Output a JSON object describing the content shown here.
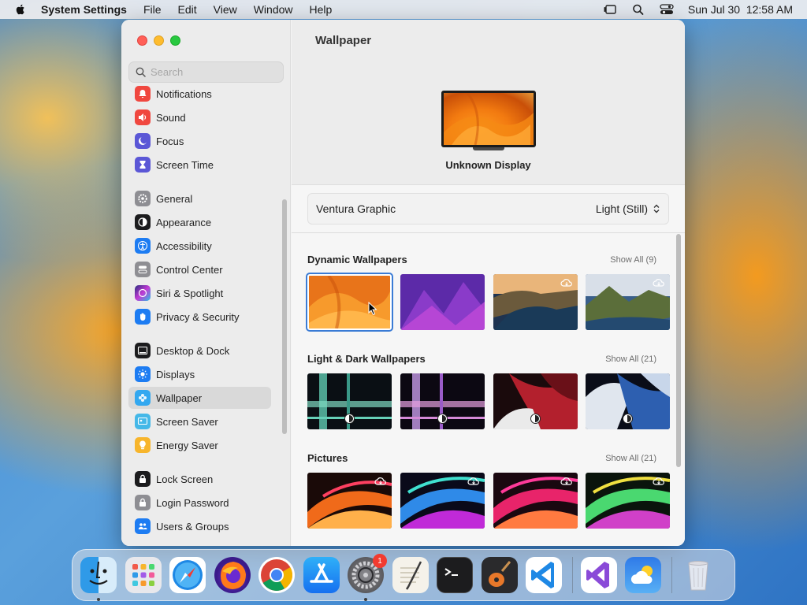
{
  "menubar": {
    "app_name": "System Settings",
    "items": [
      "File",
      "Edit",
      "View",
      "Window",
      "Help"
    ],
    "datetime": "Sun Jul 30  12:58 AM"
  },
  "sidebar": {
    "search_placeholder": "Search",
    "items": [
      {
        "label": "Notifications",
        "icon": "bell-icon",
        "color": "#f0473f"
      },
      {
        "label": "Sound",
        "icon": "speaker-icon",
        "color": "#f0473f"
      },
      {
        "label": "Focus",
        "icon": "moon-icon",
        "color": "#5b57d6"
      },
      {
        "label": "Screen Time",
        "icon": "hourglass-icon",
        "color": "#5b57d6"
      },
      {
        "label": "General",
        "icon": "gear-icon",
        "color": "#8e8e93"
      },
      {
        "label": "Appearance",
        "icon": "appearance-icon",
        "color": "#1c1c1e"
      },
      {
        "label": "Accessibility",
        "icon": "accessibility-icon",
        "color": "#1d7cf2"
      },
      {
        "label": "Control Center",
        "icon": "toggles-icon",
        "color": "#8e8e93"
      },
      {
        "label": "Siri & Spotlight",
        "icon": "siri-icon",
        "color": "#7b3fe4"
      },
      {
        "label": "Privacy & Security",
        "icon": "hand-icon",
        "color": "#1d7cf2"
      },
      {
        "label": "Desktop & Dock",
        "icon": "dock-icon",
        "color": "#1c1c1e"
      },
      {
        "label": "Displays",
        "icon": "sun-icon",
        "color": "#1d7cf2"
      },
      {
        "label": "Wallpaper",
        "icon": "flower-icon",
        "color": "#33a8f0"
      },
      {
        "label": "Screen Saver",
        "icon": "screensaver-icon",
        "color": "#45b8e8"
      },
      {
        "label": "Energy Saver",
        "icon": "battery-icon",
        "color": "#f7b52c"
      },
      {
        "label": "Lock Screen",
        "icon": "lock-icon",
        "color": "#1c1c1e"
      },
      {
        "label": "Login Password",
        "icon": "lock-icon",
        "color": "#8e8e93"
      },
      {
        "label": "Users & Groups",
        "icon": "users-icon",
        "color": "#1d7cf2"
      }
    ],
    "selected": "Wallpaper"
  },
  "content": {
    "title": "Wallpaper",
    "display_name": "Unknown Display",
    "current_wallpaper": "Ventura Graphic",
    "mode": "Light (Still)",
    "sections": [
      {
        "title": "Dynamic Wallpapers",
        "show_all": "Show All (9)"
      },
      {
        "title": "Light & Dark Wallpapers",
        "show_all": "Show All (21)"
      },
      {
        "title": "Pictures",
        "show_all": "Show All (21)"
      }
    ]
  },
  "dock": {
    "apps": [
      "Finder",
      "Launchpad",
      "Safari",
      "Firefox",
      "Chrome",
      "App Store",
      "System Settings",
      "TextEdit",
      "Terminal",
      "GarageBand",
      "VS Code",
      "Visual Studio",
      "Weather",
      "Trash"
    ],
    "settings_badge": "1"
  },
  "colors": {
    "accent": "#3a7bd5",
    "selection": "#d9d9d9"
  }
}
